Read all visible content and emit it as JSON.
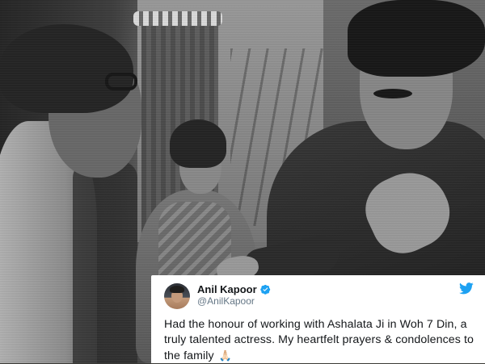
{
  "tweet": {
    "display_name": "Anil Kapoor",
    "handle": "@AnilKapoor",
    "text": "Had the honour of working with Ashalata Ji in Woh 7 Din, a truly talented actress. My heartfelt prayers & condolences to the family",
    "emoji": "🙏🏻",
    "verified": true,
    "icons": {
      "brand": "twitter-bird-icon",
      "badge": "verified-badge-icon",
      "emoji": "folded-hands-icon"
    },
    "colors": {
      "brand": "#1da1f2",
      "handle": "#657786",
      "text": "#14171a"
    }
  },
  "photo": {
    "style": "black-and-white film still",
    "subjects": [
      "man with glasses (left)",
      "woman in saree (center)",
      "man with mustache, hand on chest (right)"
    ]
  }
}
